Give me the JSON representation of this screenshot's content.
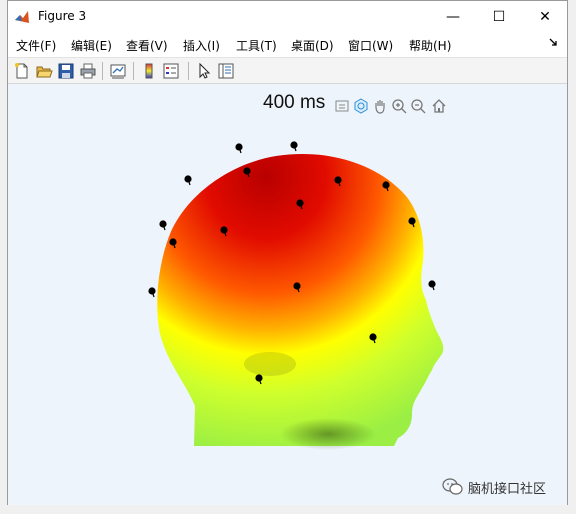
{
  "window": {
    "title": "Figure 3",
    "controls": {
      "minimize": "—",
      "maximize": "☐",
      "close": "✕"
    }
  },
  "menu": {
    "items": [
      "文件(F)",
      "编辑(E)",
      "查看(V)",
      "插入(I)",
      "工具(T)",
      "桌面(D)",
      "窗口(W)",
      "帮助(H)"
    ]
  },
  "toolbar": {
    "buttons": [
      "new-figure-icon",
      "open-file-icon",
      "save-icon",
      "print-icon",
      "link-plot-icon",
      "colorbar-icon",
      "legend-icon",
      "pointer-icon",
      "property-inspector-icon"
    ]
  },
  "axes": {
    "title": "400 ms",
    "toolbar": [
      "export-icon",
      "rotate-3d-icon",
      "pan-icon",
      "zoom-in-icon",
      "zoom-out-icon",
      "home-icon"
    ]
  },
  "colors": {
    "head_top": "#cc0000",
    "head_mid": "#ff6a00",
    "head_yellow": "#ffff00",
    "head_bottom": "#a8ff4a",
    "electrode": "#000000",
    "figure_bg": "#eef4fb"
  },
  "watermark": {
    "text": "脑机接口社区",
    "icon": "wechat-icon"
  }
}
